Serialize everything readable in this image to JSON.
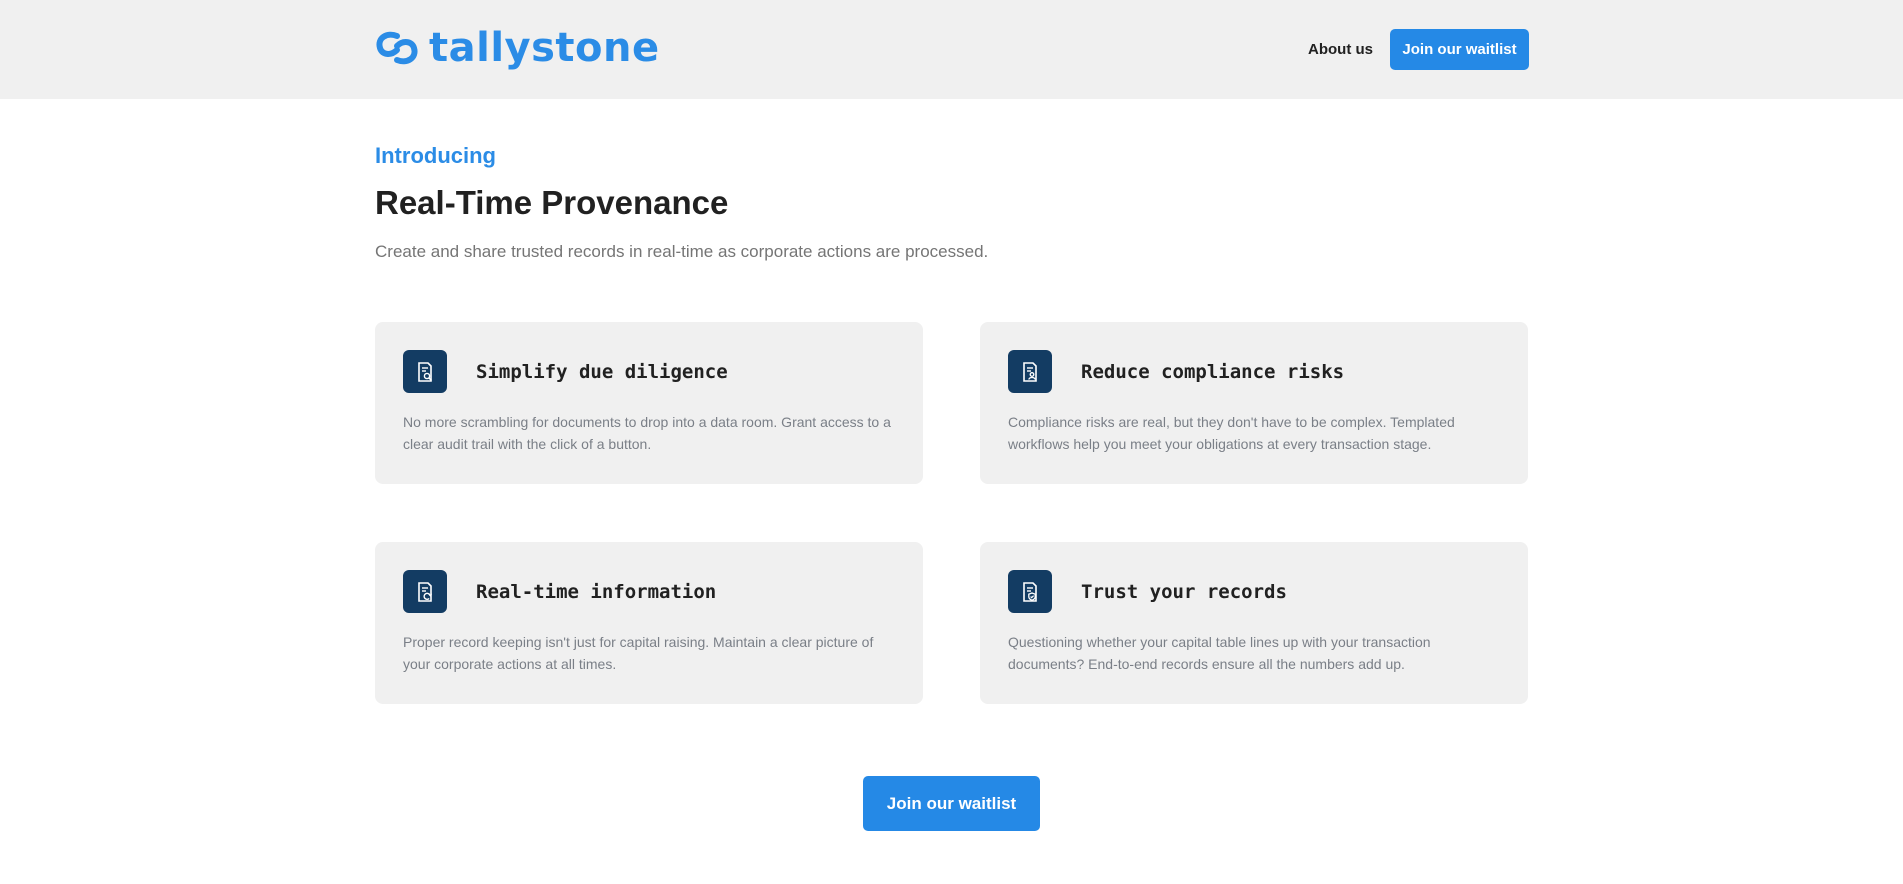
{
  "header": {
    "brand": "tallystone",
    "about_label": "About us",
    "cta_label": "Join our waitlist"
  },
  "intro": {
    "eyebrow": "Introducing",
    "title": "Real-Time Provenance",
    "subtitle": "Create and share trusted records in real-time as corporate actions are processed."
  },
  "features": [
    {
      "icon": "document-search-icon",
      "title": "Simplify due diligence",
      "body": "No more scrambling for documents to drop into a data room. Grant access to a clear audit trail with the click of a button."
    },
    {
      "icon": "document-user-icon",
      "title": "Reduce compliance risks",
      "body": "Compliance risks are real, but they don't have to be complex. Templated workflows help you meet your obligations at every transaction stage."
    },
    {
      "icon": "document-refresh-icon",
      "title": "Real-time information",
      "body": "Proper record keeping isn't just for capital raising. Maintain a clear picture of your corporate actions at all times."
    },
    {
      "icon": "document-shield-icon",
      "title": "Trust your records",
      "body": "Questioning whether your capital table lines up with your transaction documents? End-to-end records ensure all the numbers add up."
    }
  ],
  "footer": {
    "cta_label": "Join our waitlist"
  },
  "colors": {
    "brand_blue": "#2b8ce6",
    "button_blue": "#2589e6",
    "icon_navy": "#133c63",
    "panel_gray": "#f0f0f0"
  }
}
